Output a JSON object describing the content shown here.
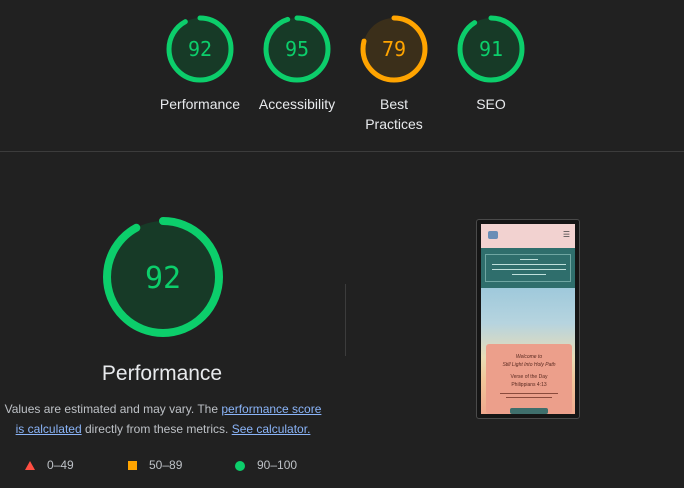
{
  "top_scores": [
    {
      "value": 92,
      "label": "Performance",
      "rating": "pass"
    },
    {
      "value": 95,
      "label": "Accessibility",
      "rating": "pass"
    },
    {
      "value": 79,
      "label": "Best Practices",
      "rating": "average"
    },
    {
      "value": 91,
      "label": "SEO",
      "rating": "pass"
    }
  ],
  "colors": {
    "pass": "#0cce6b",
    "pass_bg": "#173a27",
    "average": "#ffa400",
    "average_bg": "#3b2f1a",
    "fail": "#ff4e42"
  },
  "main": {
    "score": 92,
    "title": "Performance",
    "desc_prefix": "Values are estimated and may vary. The ",
    "desc_link1": "performance score is calculated",
    "desc_middle": " directly from these metrics. ",
    "desc_link2": "See calculator."
  },
  "legend": [
    {
      "icon": "triangle-icon",
      "range": "0–49"
    },
    {
      "icon": "square-icon",
      "range": "50–89"
    },
    {
      "icon": "circle-icon",
      "range": "90–100"
    }
  ],
  "thumbnail": {
    "card_lines": [
      "Welcome to",
      "Still Light Into Holy Path",
      "Verse of the Day",
      "Philippians 4:13"
    ]
  }
}
